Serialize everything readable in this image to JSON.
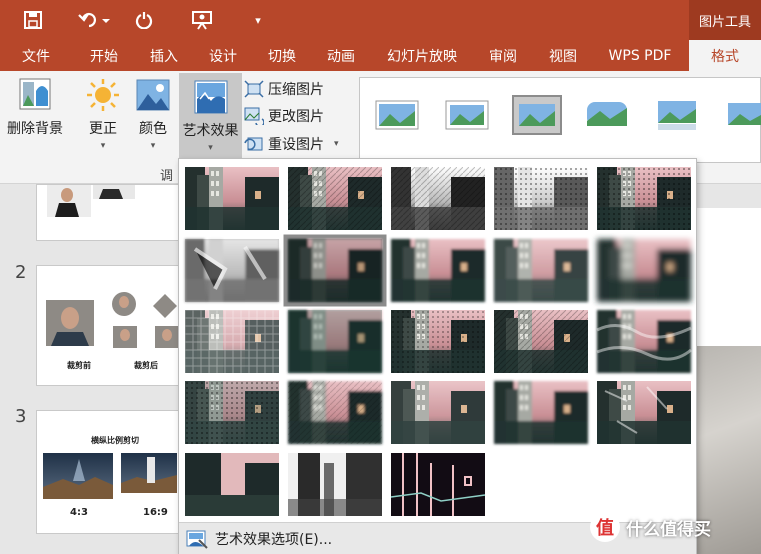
{
  "context_tab": "图片工具",
  "icons": {
    "save": "save-icon",
    "undo": "undo-icon",
    "redo": "redo-icon",
    "present": "present-icon",
    "customize": "customize-qat-icon"
  },
  "tabs": [
    "文件",
    "开始",
    "插入",
    "设计",
    "切换",
    "动画",
    "幻灯片放映",
    "审阅",
    "视图",
    "WPS PDF",
    "格式"
  ],
  "active_tab": "格式",
  "ribbon": {
    "remove_bg": "删除背景",
    "corrections": "更正",
    "color": "颜色",
    "artistic": "艺术效果",
    "compress": "压缩图片",
    "change": "更改图片",
    "reset": "重设图片",
    "group_label_partial": "调"
  },
  "slides": {
    "num2": "2",
    "num3": "3",
    "s2_cap_before": "裁剪前",
    "s2_cap_after": "裁剪后",
    "s3_title": "横纵比例剪切",
    "s3_cap1": "4:3",
    "s3_cap2": "16:9"
  },
  "dropdown": {
    "footer_label": "艺术效果选项(E)...",
    "effect_count": 23,
    "selected_index": 6
  },
  "watermark": {
    "badge": "值",
    "text": "什么值得买"
  },
  "colors": {
    "accent": "#b7472a",
    "ribbon_bg": "#f3f3f3",
    "pane_bg": "#e6e6e6"
  }
}
